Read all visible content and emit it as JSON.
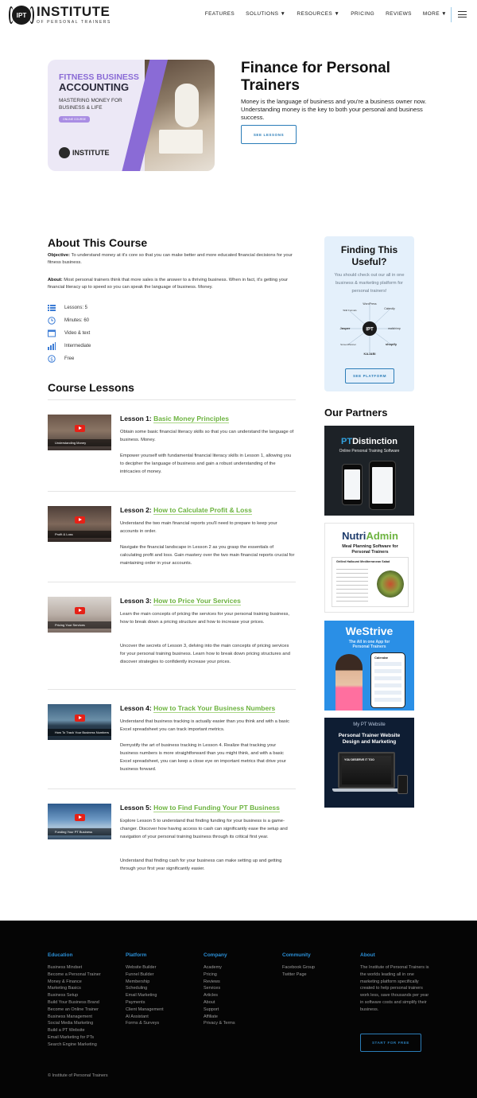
{
  "header": {
    "logo_badge": "IPT",
    "logo_title": "INSTITUTE",
    "logo_sub": "OF PERSONAL TRAINERS",
    "nav": [
      {
        "label": "FEATURES"
      },
      {
        "label": "SOLUTIONS ▼"
      },
      {
        "label": "RESOURCES ▼"
      },
      {
        "label": "PRICING"
      },
      {
        "label": "REVIEWS"
      },
      {
        "label": "MORE ▼"
      }
    ]
  },
  "hero": {
    "image": {
      "line1": "FITNESS BUSINESS",
      "line2": "ACCOUNTING",
      "line3": "MASTERING MONEY FOR BUSINESS & LIFE",
      "pill": "ONLINE COURSE",
      "logo": "INSTITUTE"
    },
    "title": "Finance for Personal Trainers",
    "description": "Money is the language of business and you're a business owner now. Understanding money is the key to both your personal and business success.",
    "button": "SEE LESSONS"
  },
  "about": {
    "title": "About This Course",
    "objective_label": "Objective:",
    "objective": "To understand money at it's core so that you can make better and more educated financial decisions for your fitness business.",
    "about_label": "About:",
    "about_text": "Most personal trainers think that more sales is the answer to a thriving business. When in fact, it's getting your financial literacy up to speed so you can speak the language of business. Money.",
    "meta": [
      {
        "icon": "list-icon",
        "text": "Lessons: 5"
      },
      {
        "icon": "clock-icon",
        "text": "Minutes: 60"
      },
      {
        "icon": "window-icon",
        "text": "Video & text"
      },
      {
        "icon": "bar-chart-icon",
        "text": "Intermediate"
      },
      {
        "icon": "dollar-icon",
        "text": "Free"
      }
    ]
  },
  "lessons": {
    "title": "Course Lessons",
    "items": [
      {
        "prefix": "Lesson 1:",
        "name": "Basic Money Principles",
        "thumb": "Understanding Money",
        "p1": "Obtain some basic financial literacy skills so that you can understand the language of business. Money.",
        "p2": "Empower yourself with fundamental financial literacy skills in Lesson 1, allowing you to decipher the language of business and gain a robust understanding of the intricacies of money."
      },
      {
        "prefix": "Lesson 2:",
        "name": "How to Calculate Profit & Loss",
        "thumb": "Profit & Loss",
        "p1": "Understand the two main financial reports you'll need to prepare to keep your accounts in order.",
        "p2": "Navigate the financial landscape in Lesson 2 as you grasp the essentials of calculating profit and loss. Gain mastery over the two main financial reports crucial for maintaining order in your accounts."
      },
      {
        "prefix": "Lesson 3:",
        "name": "How to Price Your Services",
        "thumb": "Pricing Your Services",
        "p1": "Learn the main concepts of pricing the services for your personal training business, how to break down a pricing structure and how to increase your prices.",
        "p2": "Uncover the secrets of Lesson 3, delving into the main concepts of pricing services for your personal training business. Learn how to break down pricing structures and discover strategies to confidently increase your prices."
      },
      {
        "prefix": "Lesson 4:",
        "name": "How to Track Your Business Numbers",
        "thumb": "How To Track Your Business Numbers",
        "p1": "Understand that business tracking is actually easier than you think and with a basic Excel spreadsheet you can track important metrics.",
        "p2": "Demystify the art of business tracking in Lesson 4. Realize that tracking your business numbers is more straightforward than you might think, and with a basic Excel spreadsheet, you can keep a close eye on important metrics that drive your business forward."
      },
      {
        "prefix": "Lesson 5:",
        "name": "How to Find Funding Your PT Business",
        "thumb": "Funding Your PT Business",
        "p1": "Explore Lesson 5 to understand that finding funding for your business is a game-changer. Discover how having access to cash can significantly ease the setup and navigation of your personal training business through its critical first year.",
        "p2": "Understand that finding cash for your business can make setting up and getting through your first year significantly easier."
      }
    ]
  },
  "cta": {
    "title": "Finding This Useful?",
    "description": "You should check out our all in one business & marketing platform for personal trainers!",
    "hub_center": "IPT",
    "hub_logos": [
      "WordPress",
      "Calendly",
      "mailchimp",
      "shopify",
      "KAJABI",
      "ScreenPlanner",
      "Jasper",
      "Wild Funnels"
    ],
    "button": "SEE PLATFORM"
  },
  "partners": {
    "title": "Our Partners",
    "ptd": {
      "brand1": "PT",
      "brand2": "Distinction",
      "tag": "Online Personal Training Software"
    },
    "nutri": {
      "brand1": "Nutri",
      "brand2": "Admin",
      "tag": "Meal Planning Software for Personal Trainers",
      "recipe": "Grilled Halloumi Mediterranean Salad"
    },
    "westrive": {
      "brand": "WeStrive",
      "tag": "The All in one App for Personal Trainers",
      "calendar": "Calendar"
    },
    "mypt": {
      "brand": "My PT Website",
      "tag": "Personal Trainer Website Design and Marketing",
      "screen": "YOU DESERVE IT TOO"
    }
  },
  "footer": {
    "columns": [
      {
        "title": "Education",
        "links": [
          "Business Mindset",
          "Become a Personal Trainer",
          "Money & Finance",
          "Marketing Basics",
          "Business Setup",
          "Build Your Business Brand",
          "Become an Online Trainer",
          "Business Management",
          "Social Media Marketing",
          "Build a PT Website",
          "Email Marketing for PTs",
          "Search Engine Marketing"
        ]
      },
      {
        "title": "Platform",
        "links": [
          "Website Builder",
          "Funnel Builder",
          "Membership",
          "Scheduling",
          "Email Marketing",
          "Payments",
          "Client Management",
          "AI Assistant",
          "Forms & Surveys"
        ]
      },
      {
        "title": "Company",
        "links": [
          "Academy",
          "Pricing",
          "Reviews",
          "Services",
          "Articles",
          "About",
          "Support",
          "Affiliate",
          "Privacy & Terms"
        ]
      },
      {
        "title": "Community",
        "links": [
          "Facebook Group",
          "Twitter Page"
        ]
      }
    ],
    "about_title": "About",
    "about_text": "The Institute of Personal Trainers is the worlds leading all in one marketing platform specifically created to help personal trainers work less, save thousands per year in software costs and simplify their business.",
    "button": "START FOR FREE",
    "copyright": "© Institute of Personal Trainers"
  }
}
